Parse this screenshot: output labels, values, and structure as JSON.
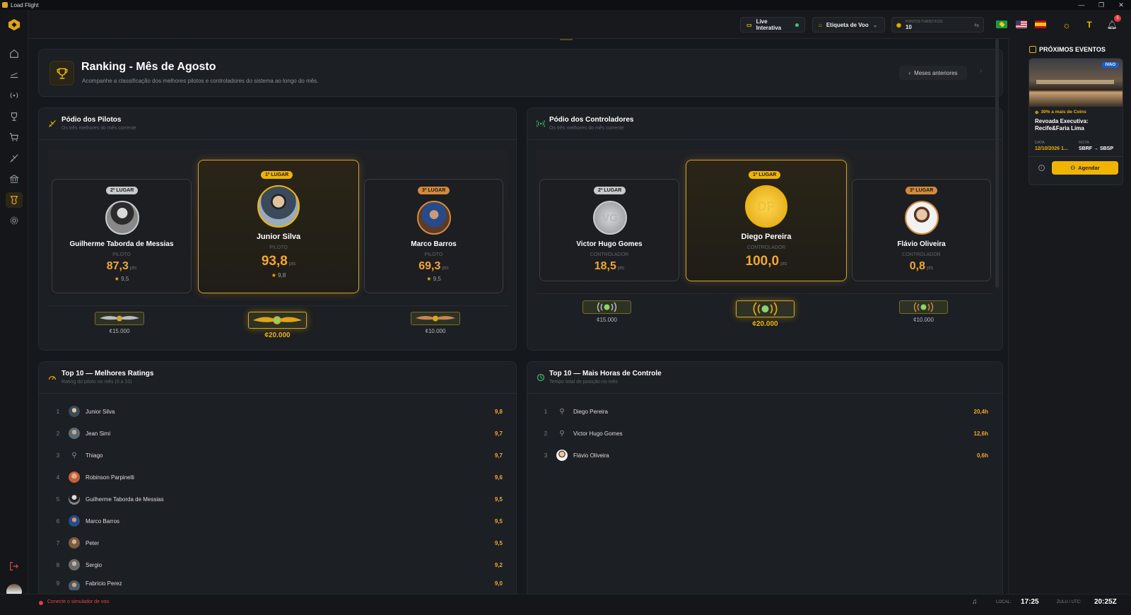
{
  "window": {
    "title": "Load Flight"
  },
  "topbar": {
    "live_label": "Live Interativa",
    "tag_label": "Etiqueta de Voo",
    "points_label": "PONTOS TURÍSTICOS",
    "points_value": "10",
    "notifications": "5"
  },
  "header": {
    "title": "Ranking - Mês de Agosto",
    "subtitle": "Acompanhe a classificação dos melhores pilotos e controladores do sistema ao longo do mês.",
    "prev_months": "Meses anteriores"
  },
  "pilots": {
    "title": "Pódio dos Pilotos",
    "subtitle": "Os três melhores do mês corrente",
    "podium": [
      {
        "place": "2º LUGAR",
        "name": "Guilherme Taborda de Messias",
        "role": "PILOTO",
        "score": "87,3",
        "unit": "pts",
        "rating": "9,5",
        "prize": "¢15.000"
      },
      {
        "place": "1º LUGAR",
        "name": "Junior Silva",
        "role": "PILOTO",
        "score": "93,8",
        "unit": "pts",
        "rating": "9,8",
        "prize": "¢20.000"
      },
      {
        "place": "3º LUGAR",
        "name": "Marco Barros",
        "role": "PILOTO",
        "score": "69,3",
        "unit": "pts",
        "rating": "9,5",
        "prize": "¢10.000"
      }
    ]
  },
  "controllers": {
    "title": "Pódio dos Controladores",
    "subtitle": "Os três melhores do mês corrente",
    "podium": [
      {
        "place": "2º LUGAR",
        "name": "Victor Hugo Gomes",
        "initials": "VG",
        "role": "CONTROLADOR",
        "score": "18,5",
        "unit": "pts",
        "prize": "¢15.000"
      },
      {
        "place": "1º LUGAR",
        "name": "Diego Pereira",
        "initials": "DP",
        "role": "CONTROLADOR",
        "score": "100,0",
        "unit": "pts",
        "prize": "¢20.000"
      },
      {
        "place": "3º LUGAR",
        "name": "Flávio Oliveira",
        "role": "CONTROLADOR",
        "score": "0,8",
        "unit": "pts",
        "prize": "¢10.000"
      }
    ]
  },
  "top_ratings": {
    "title": "Top 10 — Melhores Ratings",
    "subtitle": "Rating do piloto no mês (0 a 10)",
    "rows": [
      {
        "rank": "1",
        "name": "Junior Silva",
        "value": "9,8"
      },
      {
        "rank": "2",
        "name": "Jean Simi",
        "value": "9,7"
      },
      {
        "rank": "3",
        "name": "Thiago",
        "value": "9,7"
      },
      {
        "rank": "4",
        "name": "Robinson Parpinelli",
        "value": "9,6"
      },
      {
        "rank": "5",
        "name": "Guilherme Taborda de Messias",
        "value": "9,5"
      },
      {
        "rank": "6",
        "name": "Marco Barros",
        "value": "9,5"
      },
      {
        "rank": "7",
        "name": "Peter",
        "value": "9,5"
      },
      {
        "rank": "8",
        "name": "Sergio",
        "value": "9,2"
      },
      {
        "rank": "9",
        "name": "Fabricio Perez",
        "value": "9,0"
      }
    ]
  },
  "top_hours": {
    "title": "Top 10 — Mais Horas de Controle",
    "subtitle": "Tempo total de posição no mês",
    "rows": [
      {
        "rank": "1",
        "name": "Diego Pereira",
        "value": "20,4h"
      },
      {
        "rank": "2",
        "name": "Victor Hugo Gomes",
        "value": "12,6h"
      },
      {
        "rank": "3",
        "name": "Flávio Oliveira",
        "value": "0,6h"
      }
    ]
  },
  "events": {
    "title": "PRÓXIMOS EVENTOS",
    "network": "IVAO",
    "bonus": "30% a mais de Coins",
    "event_title": "Revoada Executiva: Recife&Faria Lima",
    "date_label": "DATA",
    "date_value": "12/10/2026 1...",
    "route_label": "ROTA",
    "route_value": "SBRF → SBSP",
    "schedule_btn": "Agendar"
  },
  "status": {
    "sim_msg": "Conecte o simulador de voo.",
    "local_label": "LOCAL:",
    "local_time": "17:25",
    "zulu_label": "ZULU / UTC:",
    "zulu_time": "20:25Z"
  }
}
